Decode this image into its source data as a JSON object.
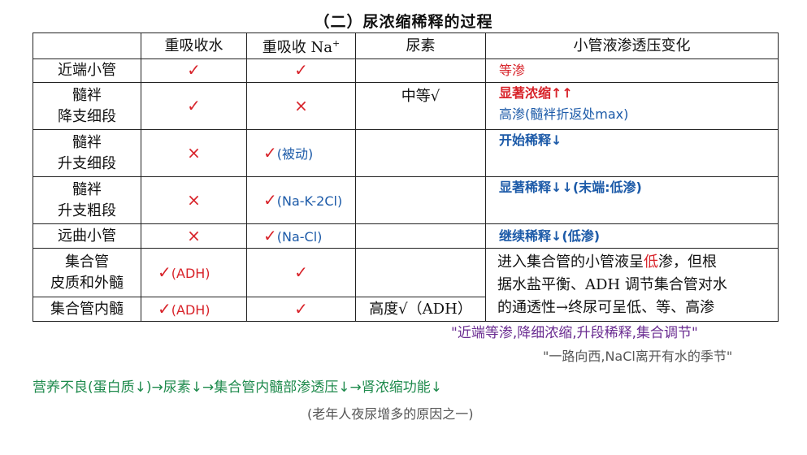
{
  "title": "（二）尿浓缩稀释的过程",
  "headers": [
    "",
    "重吸收水",
    "重吸收 Na",
    "尿素",
    "小管液渗透压变化"
  ],
  "na_superscript": "+",
  "marks": {
    "check": "✓",
    "cross": "×"
  },
  "rows": [
    {
      "seg": [
        "近端小管"
      ],
      "water": "check",
      "na": "check",
      "na_note": "",
      "urea": "",
      "change": [
        {
          "t": "等渗",
          "c": "red"
        }
      ]
    },
    {
      "seg": [
        "髓袢",
        "降支细段"
      ],
      "water": "check",
      "na": "cross",
      "na_note": "",
      "urea": "中等√",
      "change": [
        {
          "t": "显著浓缩↑↑",
          "c": "red"
        },
        {
          "t": "高渗(髓袢折返处max)",
          "c": "blue"
        }
      ]
    },
    {
      "seg": [
        "髓袢",
        "升支细段"
      ],
      "water": "cross",
      "na": "check",
      "na_note": "(被动)",
      "urea": "",
      "change": [
        {
          "t": "开始稀释↓",
          "c": "blue"
        }
      ]
    },
    {
      "seg": [
        "髓袢",
        "升支粗段"
      ],
      "water": "cross",
      "na": "check",
      "na_note": "(Na-K-2Cl)",
      "urea": "",
      "change": [
        {
          "t": "显著稀释↓↓(末端:低渗)",
          "c": "blue"
        }
      ]
    },
    {
      "seg": [
        "远曲小管"
      ],
      "water": "cross",
      "na": "check",
      "na_note": "(Na-Cl)",
      "urea": "",
      "change": [
        {
          "t": "继续稀释↓(低渗)",
          "c": "blue"
        }
      ]
    },
    {
      "seg": [
        "集合管",
        "皮质和外髓"
      ],
      "water": "check",
      "water_note": "(ADH)",
      "na": "check",
      "na_note": "",
      "urea": ""
    },
    {
      "seg": [
        "集合管内髓"
      ],
      "water": "check",
      "water_note": "(ADH)",
      "na": "check",
      "na_note": "",
      "urea": "高度√（ADH）"
    }
  ],
  "collecting_note": {
    "l1a": "进入集合管的小管液呈",
    "l1red": "低",
    "l1b": "渗，但根",
    "l2": "据水盐平衡、ADH 调节集合管对水",
    "l3": "的通透性→终尿可呈低、等、高渗"
  },
  "mnemonic": "\"近端等渗,降细浓缩,升段稀释,集合调节\"",
  "mnemonic2": "\"一路向西,NaCl离开有水的季节\"",
  "footer1": "营养不良(蛋白质↓)→尿素↓→集合管内髓部渗透压↓→肾浓缩功能↓",
  "footer2": "(老年人夜尿增多的原因之一)",
  "colors": {
    "red": "#d8232a",
    "blue": "#1c5aa8",
    "purple": "#6a2c91",
    "green": "#1e8a4c",
    "gray": "#555555"
  }
}
